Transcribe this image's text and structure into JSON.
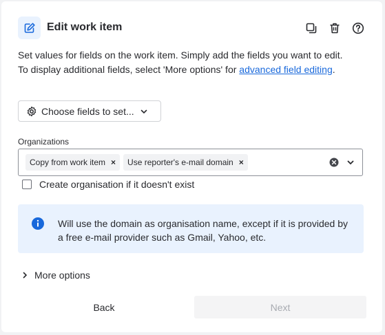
{
  "header": {
    "title": "Edit work item",
    "icon": "edit-icon",
    "actions": [
      "duplicate-icon",
      "trash-icon",
      "help-icon"
    ]
  },
  "description": {
    "line1": "Set values for fields on the work item. Simply add the fields you want to edit.",
    "line2_prefix": "To display additional fields, select 'More options' for ",
    "line2_link": "advanced field editing",
    "line2_suffix": "."
  },
  "choose_fields": {
    "label": "Choose fields to set...",
    "icon": "gear-icon"
  },
  "organizations": {
    "label": "Organizations",
    "tags": [
      "Copy from work item",
      "Use reporter's e-mail domain"
    ]
  },
  "create_org_checkbox": {
    "label": "Create organisation if it doesn't exist",
    "checked": false
  },
  "info_banner": {
    "text": "Will use the domain as organisation name, except if it is provided by a free e-mail provider such as Gmail, Yahoo, etc.",
    "color": "#e9f2fe",
    "icon_color": "#1868db"
  },
  "more_options": {
    "label": "More options"
  },
  "footer": {
    "back_label": "Back",
    "next_label": "Next"
  },
  "colors": {
    "accent": "#1868db",
    "link": "#1868db",
    "text": "#292a2e"
  }
}
